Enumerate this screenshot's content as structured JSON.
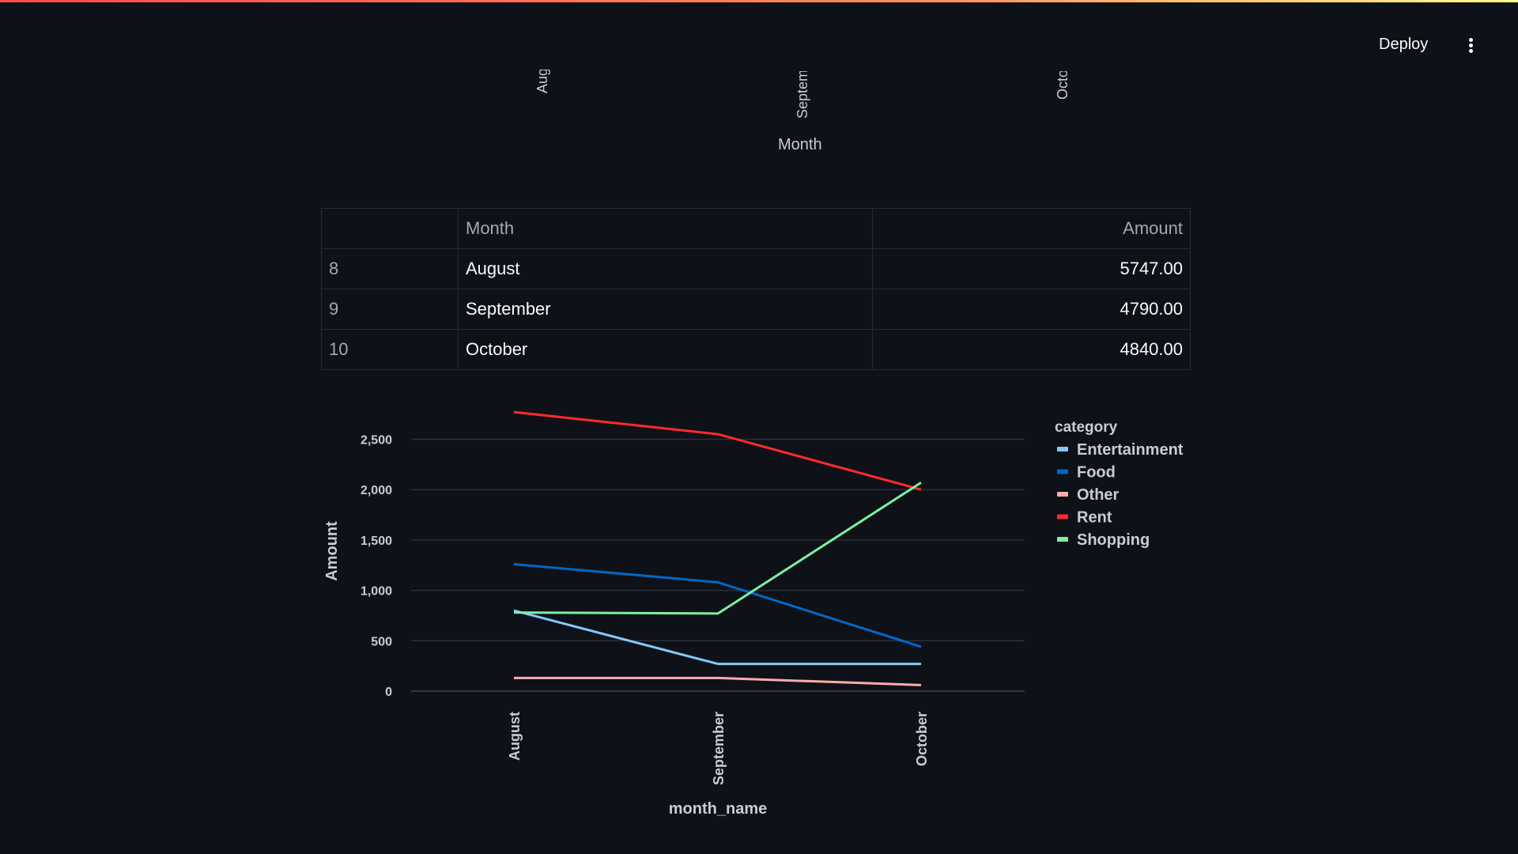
{
  "header": {
    "deploy_label": "Deploy"
  },
  "top_chart": {
    "tick_labels": [
      "August",
      "September",
      "October"
    ],
    "x_title": "Month"
  },
  "table": {
    "columns": [
      "",
      "Month",
      "Amount"
    ],
    "rows": [
      {
        "index": "8",
        "month": "August",
        "amount": "5747.00"
      },
      {
        "index": "9",
        "month": "September",
        "amount": "4790.00"
      },
      {
        "index": "10",
        "month": "October",
        "amount": "4840.00"
      }
    ]
  },
  "chart_data": {
    "type": "line",
    "categories": [
      "August",
      "September",
      "October"
    ],
    "xlabel": "month_name",
    "ylabel": "Amount",
    "ylim": [
      0,
      2800
    ],
    "yticks": [
      0,
      500,
      1000,
      1500,
      2000,
      2500
    ],
    "ytick_labels": [
      "0",
      "500",
      "1,000",
      "1,500",
      "2,000",
      "2,500"
    ],
    "grid": true,
    "legend_title": "category",
    "legend_position": "top-right",
    "series": [
      {
        "name": "Entertainment",
        "color": "#83c9ff",
        "values": [
          800,
          270,
          270
        ]
      },
      {
        "name": "Food",
        "color": "#0068c9",
        "values": [
          1260,
          1080,
          440
        ]
      },
      {
        "name": "Other",
        "color": "#ffabab",
        "values": [
          130,
          130,
          60
        ]
      },
      {
        "name": "Rent",
        "color": "#ff2b2b",
        "values": [
          2770,
          2550,
          2000
        ]
      },
      {
        "name": "Shopping",
        "color": "#7defa1",
        "values": [
          780,
          770,
          2070
        ]
      }
    ]
  }
}
